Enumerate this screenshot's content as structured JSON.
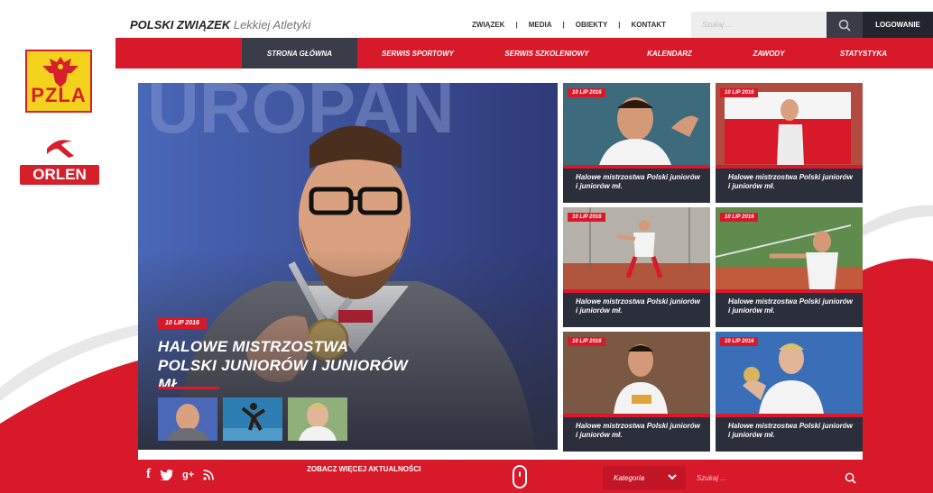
{
  "brand": {
    "bold": "POLSKI ZWIĄZEK",
    "light": "Lekkiej Atletyki"
  },
  "left_logos": {
    "pzla": "PZLA",
    "orlen": "ORLEN"
  },
  "topnav": [
    "ZWIĄZEK",
    "MEDIA",
    "OBIEKTY",
    "KONTAKT"
  ],
  "topnav_sep": "|",
  "search_top": {
    "placeholder": "Szukaj ..."
  },
  "login": "LOGOWANIE",
  "mainnav": [
    {
      "label": "STRONA GŁÓWNA",
      "active": true
    },
    {
      "label": "SERWIS SPORTOWY"
    },
    {
      "label": "SERWIS SZKOLENIOWY"
    },
    {
      "label": "KALENDARZ"
    },
    {
      "label": "ZAWODY"
    },
    {
      "label": "STATYSTYKA"
    }
  ],
  "hero": {
    "date": "10 LIP 2016",
    "title": "HALOWE MISTRZOSTWA POLSKI JUNIORÓW I JUNIORÓW MŁ."
  },
  "tiles": [
    {
      "date": "10 LIP 2016",
      "caption": "Halowe mistrzostwa Polski juniorów i juniorów mł."
    },
    {
      "date": "10 LIP 2016",
      "caption": "Halowe mistrzostwa Polski juniorów i juniorów mł."
    },
    {
      "date": "10 LIP 2016",
      "caption": "Halowe mistrzostwa Polski juniorów i juniorów mł."
    },
    {
      "date": "10 LIP 2016",
      "caption": "Halowe mistrzostwa Polski juniorów i juniorów mł."
    },
    {
      "date": "10 LIP 2016",
      "caption": "Halowe mistrzostwa Polski juniorów i juniorów mł."
    },
    {
      "date": "10 LIP 2016",
      "caption": "Halowe mistrzostwa Polski juniorów i juniorów mł."
    }
  ],
  "footer": {
    "social": [
      "f",
      "g+"
    ],
    "social_icons": [
      "facebook-icon",
      "twitter-icon",
      "google-plus-icon",
      "rss-icon"
    ],
    "more_news": "ZOBACZ WIĘCEJ AKTUALNOŚCI",
    "category": "Kategoria",
    "search_placeholder": "Szukaj ..."
  },
  "colors": {
    "red": "#d8192a",
    "dark": "#2b2e3b",
    "navy": "#3a3d48",
    "yellow": "#f2d21c"
  }
}
